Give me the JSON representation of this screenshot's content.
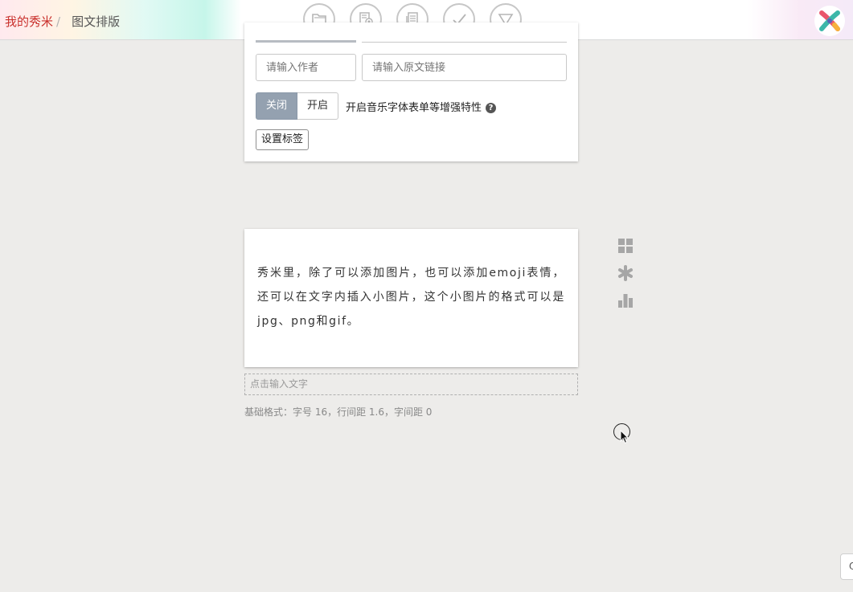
{
  "breadcrumb": {
    "home": "我的秀米",
    "separator": "/",
    "current": "图文排版"
  },
  "toolbar": {
    "icons": [
      "folder-icon",
      "preview-icon",
      "copy-icon",
      "check-icon",
      "dropdown-triangle-icon"
    ]
  },
  "logo": {
    "icon": "xiumi-x-logo",
    "colors": [
      "#e9566b",
      "#f6b13d",
      "#3cb7a9",
      "#5a63b8"
    ]
  },
  "settings": {
    "author_placeholder": "请输入作者",
    "link_placeholder": "请输入原文链接",
    "toggle": {
      "off_label": "关闭",
      "on_label": "开启",
      "selected": "关闭",
      "description": "开启音乐字体表单等增强特性",
      "help_icon": "?"
    },
    "tag_button": "设置标签"
  },
  "content": {
    "text": "秀米里，除了可以添加图片，也可以添加emoji表情，还可以在文字内插入小图片，这个小图片的格式可以是jpg、png和gif。"
  },
  "side_tools": [
    "grid-icon",
    "asterisk-icon",
    "bar-chart-icon"
  ],
  "editor": {
    "input_placeholder": "点击输入文字",
    "format_note": "基础格式：字号 16，行间距 1.6，字间距 0"
  },
  "corner_button": {
    "label": "Q"
  },
  "colors": {
    "accent_red": "#c9302c",
    "toggle_selected": "#94a1b0",
    "background": "#edecea"
  }
}
